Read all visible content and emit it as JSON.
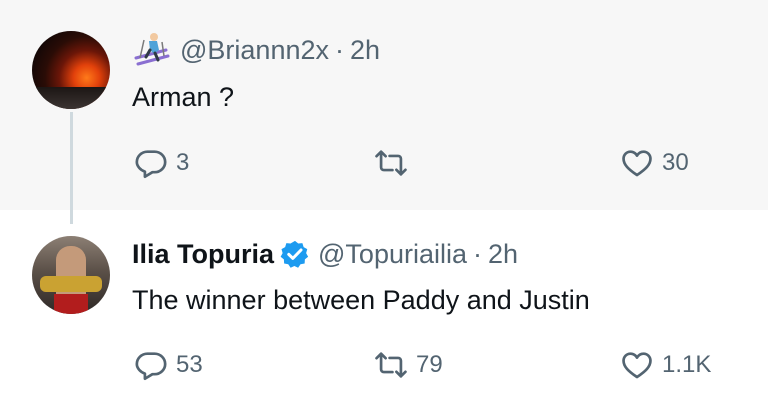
{
  "colors": {
    "text": "#0f1419",
    "muted": "#536471",
    "verified": "#1d9bf0",
    "thread_line": "#cfd9de"
  },
  "tweets": [
    {
      "handle": "@Briannn2x",
      "time": "2h",
      "text": "Arman ?",
      "emoji": "skier-emoji",
      "stats": {
        "replies": "3",
        "reposts": "",
        "likes": "30"
      }
    },
    {
      "display_name": "Ilia Topuria",
      "verified": true,
      "handle": "@Topuriailia",
      "time": "2h",
      "text": "The winner between Paddy and Justin",
      "stats": {
        "replies": "53",
        "reposts": "79",
        "likes": "1.1K"
      }
    }
  ],
  "separator": "·"
}
